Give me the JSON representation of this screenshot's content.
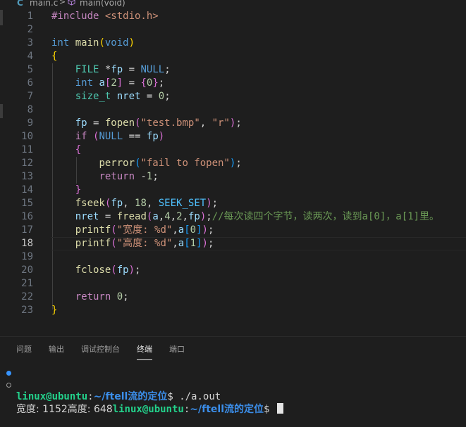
{
  "breadcrumb": {
    "file": "main.c",
    "separator": ">",
    "symbol": "main(void)",
    "lang_glyph": "C"
  },
  "editor": {
    "current_line": 18,
    "lines": [
      {
        "n": "1",
        "t": [
          [
            "pre",
            "#include "
          ],
          [
            "str",
            "<stdio.h>"
          ]
        ]
      },
      {
        "n": "2",
        "t": []
      },
      {
        "n": "3",
        "t": [
          [
            "kw",
            "int "
          ],
          [
            "fn",
            "main"
          ],
          [
            "b1",
            "("
          ],
          [
            "kw",
            "void"
          ],
          [
            "b1",
            ")"
          ]
        ]
      },
      {
        "n": "4",
        "t": [
          [
            "b1",
            "{"
          ]
        ]
      },
      {
        "n": "5",
        "t": [
          [
            "pun",
            "    "
          ],
          [
            "type",
            "FILE "
          ],
          [
            "pun",
            "*"
          ],
          [
            "var",
            "fp"
          ],
          [
            "pun",
            " = "
          ],
          [
            "kw",
            "NULL"
          ],
          [
            "pun",
            ";"
          ]
        ]
      },
      {
        "n": "6",
        "t": [
          [
            "pun",
            "    "
          ],
          [
            "kw",
            "int "
          ],
          [
            "var",
            "a"
          ],
          [
            "b2",
            "["
          ],
          [
            "num",
            "2"
          ],
          [
            "b2",
            "]"
          ],
          [
            "pun",
            " = "
          ],
          [
            "b2",
            "{"
          ],
          [
            "num",
            "0"
          ],
          [
            "b2",
            "}"
          ],
          [
            "pun",
            ";"
          ]
        ]
      },
      {
        "n": "7",
        "t": [
          [
            "pun",
            "    "
          ],
          [
            "type",
            "size_t "
          ],
          [
            "var",
            "nret"
          ],
          [
            "pun",
            " = "
          ],
          [
            "num",
            "0"
          ],
          [
            "pun",
            ";"
          ]
        ]
      },
      {
        "n": "8",
        "t": []
      },
      {
        "n": "9",
        "t": [
          [
            "pun",
            "    "
          ],
          [
            "var",
            "fp"
          ],
          [
            "pun",
            " = "
          ],
          [
            "fn",
            "fopen"
          ],
          [
            "b2",
            "("
          ],
          [
            "str",
            "\"test.bmp\""
          ],
          [
            "pun",
            ", "
          ],
          [
            "str",
            "\"r\""
          ],
          [
            "b2",
            ")"
          ],
          [
            "pun",
            ";"
          ]
        ]
      },
      {
        "n": "10",
        "t": [
          [
            "pun",
            "    "
          ],
          [
            "ctrl",
            "if "
          ],
          [
            "b2",
            "("
          ],
          [
            "kw",
            "NULL"
          ],
          [
            "pun",
            " == "
          ],
          [
            "var",
            "fp"
          ],
          [
            "b2",
            ")"
          ]
        ]
      },
      {
        "n": "11",
        "t": [
          [
            "pun",
            "    "
          ],
          [
            "b2",
            "{"
          ]
        ]
      },
      {
        "n": "12",
        "t": [
          [
            "pun",
            "        "
          ],
          [
            "fn",
            "perror"
          ],
          [
            "b3",
            "("
          ],
          [
            "str",
            "\"fail to fopen\""
          ],
          [
            "b3",
            ")"
          ],
          [
            "pun",
            ";"
          ]
        ]
      },
      {
        "n": "13",
        "t": [
          [
            "pun",
            "        "
          ],
          [
            "ctrl",
            "return "
          ],
          [
            "pun",
            "-"
          ],
          [
            "num",
            "1"
          ],
          [
            "pun",
            ";"
          ]
        ]
      },
      {
        "n": "14",
        "t": [
          [
            "pun",
            "    "
          ],
          [
            "b2",
            "}"
          ]
        ]
      },
      {
        "n": "15",
        "t": [
          [
            "pun",
            "    "
          ],
          [
            "fn",
            "fseek"
          ],
          [
            "b2",
            "("
          ],
          [
            "var",
            "fp"
          ],
          [
            "pun",
            ", "
          ],
          [
            "num",
            "18"
          ],
          [
            "pun",
            ", "
          ],
          [
            "const",
            "SEEK_SET"
          ],
          [
            "b2",
            ")"
          ],
          [
            "pun",
            ";"
          ]
        ]
      },
      {
        "n": "16",
        "t": [
          [
            "pun",
            "    "
          ],
          [
            "var",
            "nret"
          ],
          [
            "pun",
            " = "
          ],
          [
            "fn",
            "fread"
          ],
          [
            "b2",
            "("
          ],
          [
            "var",
            "a"
          ],
          [
            "pun",
            ","
          ],
          [
            "num",
            "4"
          ],
          [
            "pun",
            ","
          ],
          [
            "num",
            "2"
          ],
          [
            "pun",
            ","
          ],
          [
            "var",
            "fp"
          ],
          [
            "b2",
            ")"
          ],
          [
            "pun",
            ";"
          ],
          [
            "cmt",
            "//每次读四个字节，读两次，读到a[0]，a[1]里。"
          ]
        ]
      },
      {
        "n": "17",
        "t": [
          [
            "pun",
            "    "
          ],
          [
            "fn",
            "printf"
          ],
          [
            "b2",
            "("
          ],
          [
            "str",
            "\"宽度: %d\""
          ],
          [
            "pun",
            ","
          ],
          [
            "var",
            "a"
          ],
          [
            "b3",
            "["
          ],
          [
            "num",
            "0"
          ],
          [
            "b3",
            "]"
          ],
          [
            "b2",
            ")"
          ],
          [
            "pun",
            ";"
          ]
        ]
      },
      {
        "n": "18",
        "t": [
          [
            "pun",
            "    "
          ],
          [
            "fn",
            "printf"
          ],
          [
            "b2",
            "("
          ],
          [
            "str",
            "\"高度: %d\""
          ],
          [
            "pun",
            ","
          ],
          [
            "var",
            "a"
          ],
          [
            "b3",
            "["
          ],
          [
            "num",
            "1"
          ],
          [
            "b3",
            "]"
          ],
          [
            "b2",
            ")"
          ],
          [
            "pun",
            ";"
          ]
        ]
      },
      {
        "n": "19",
        "t": []
      },
      {
        "n": "20",
        "t": [
          [
            "pun",
            "    "
          ],
          [
            "fn",
            "fclose"
          ],
          [
            "b2",
            "("
          ],
          [
            "var",
            "fp"
          ],
          [
            "b2",
            ")"
          ],
          [
            "pun",
            ";"
          ]
        ]
      },
      {
        "n": "21",
        "t": []
      },
      {
        "n": "22",
        "t": [
          [
            "pun",
            "    "
          ],
          [
            "ctrl",
            "return "
          ],
          [
            "num",
            "0"
          ],
          [
            "pun",
            ";"
          ]
        ]
      },
      {
        "n": "23",
        "t": [
          [
            "b1",
            "}"
          ]
        ]
      }
    ]
  },
  "panel": {
    "tabs": [
      {
        "label": "问题",
        "active": false
      },
      {
        "label": "输出",
        "active": false
      },
      {
        "label": "调试控制台",
        "active": false
      },
      {
        "label": "终端",
        "active": true
      },
      {
        "label": "端口",
        "active": false
      }
    ]
  },
  "terminal": {
    "line1": {
      "user": "linux@ubuntu",
      "sep": ":",
      "path": "~/ftell流的定位",
      "prompt": "$ ",
      "cmd": "./a.out"
    },
    "line2": {
      "output": "宽度: 1152高度: 648",
      "user": "linux@ubuntu",
      "sep": ":",
      "path": "~/ftell流的定位",
      "prompt": "$ "
    }
  },
  "colors": {
    "background": "#1e1e1e",
    "terminal_user": "#23d18b",
    "terminal_path": "#3b8eea",
    "active_dot": "#3794ff"
  }
}
